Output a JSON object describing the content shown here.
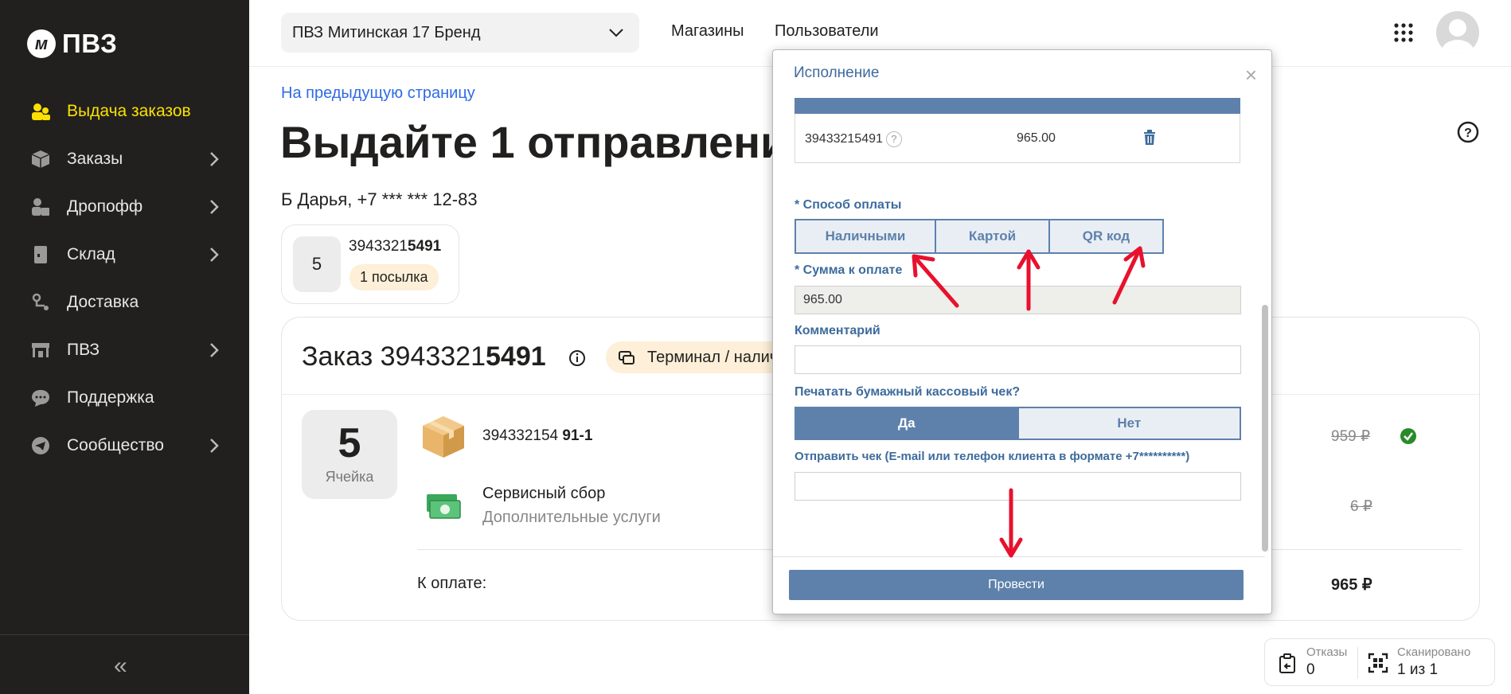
{
  "sidebar": {
    "logo_text": "ПВЗ",
    "logo_mark": "м",
    "items": [
      {
        "label": "Выдача заказов",
        "icon": "people-icon",
        "active": true
      },
      {
        "label": "Заказы",
        "icon": "box-icon"
      },
      {
        "label": "Дропофф",
        "icon": "dropoff-icon"
      },
      {
        "label": "Склад",
        "icon": "warehouse-icon"
      },
      {
        "label": "Доставка",
        "icon": "delivery-icon"
      },
      {
        "label": "ПВЗ",
        "icon": "store-icon"
      },
      {
        "label": "Поддержка",
        "icon": "chat-icon"
      },
      {
        "label": "Сообщество",
        "icon": "telegram-icon"
      }
    ],
    "collapse": "«"
  },
  "header": {
    "pvz_select": "ПВЗ Митинская 17 Бренд",
    "links": [
      "Магазины",
      "Пользователи"
    ]
  },
  "main": {
    "back_link": "На предыдущую страницу",
    "title": "Выдайте 1 отправление",
    "client": "Б Дарья, +7 *** *** 12-83",
    "parcel": {
      "cell": "5",
      "num_prefix": "3943321",
      "num_bold": "5491",
      "badge": "1 посылка"
    }
  },
  "order": {
    "title_prefix": "Заказ 3943321",
    "title_bold": "5491",
    "badge": "Терминал / наличные",
    "cell_num": "5",
    "cell_label": "Ячейка",
    "item": {
      "num_prefix": "394332154",
      "num_bold": "91-1",
      "price": "959 ₽"
    },
    "service": {
      "name": "Сервисный сбор",
      "sub": "Дополнительные услуги",
      "price": "6 ₽"
    },
    "total_label": "К оплате:",
    "total_value": "965 ₽"
  },
  "status": {
    "refusals_label": "Отказы",
    "refusals_value": "0",
    "scanned_label": "Сканировано",
    "scanned_value": "1 из 1"
  },
  "modal": {
    "title": "Исполнение",
    "close": "×",
    "row": {
      "id": "39433215491",
      "help": "?",
      "sum": "965.00"
    },
    "payment_label": "* Способ оплаты",
    "payment_methods": [
      "Наличными",
      "Картой",
      "QR код"
    ],
    "amount_label": "* Сумма к оплате",
    "amount_value": "965.00",
    "comment_label": "Комментарий",
    "comment_value": "",
    "print_label": "Печатать бумажный кассовый чек?",
    "yes": "Да",
    "no": "Нет",
    "send_label": "Отправить чек (E-mail или телефон клиента в формате +7**********)",
    "send_value": "",
    "submit": "Провести"
  },
  "colors": {
    "accent": "#fce000",
    "modal_blue": "#5e81ab",
    "annotation_red": "#e8112d"
  }
}
